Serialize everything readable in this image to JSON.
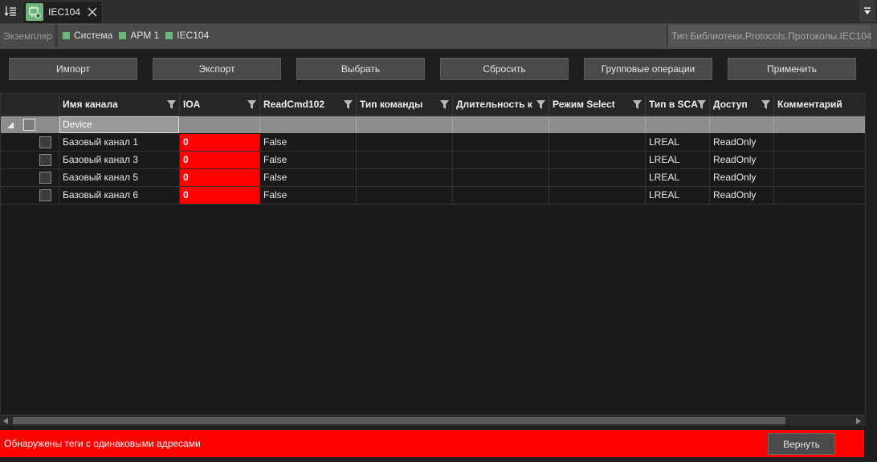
{
  "tab": {
    "title": "IEC104"
  },
  "breadcrumb": {
    "label": "Экземпляр",
    "items": [
      "Система",
      "АРМ 1",
      "IEC104"
    ],
    "library_path": "Тип Библиотеки.Protocols.Протоколы.IEC104"
  },
  "toolbar": {
    "import": "Импорт",
    "export": "Экспорт",
    "select": "Выбрать",
    "reset": "Сбросить",
    "group_ops": "Групповые операции",
    "apply": "Применить"
  },
  "table": {
    "columns": [
      "Имя канала",
      "IOA",
      "ReadCmd102",
      "Тип команды",
      "Длительность к",
      "Режим Select",
      "Тип в SCA",
      "Доступ",
      "Комментарий"
    ],
    "group": {
      "name": "Device"
    },
    "rows": [
      {
        "name": "Базовый канал 1",
        "ioa": "0",
        "readcmd": "False",
        "cmd_type": "",
        "duration": "",
        "select_mode": "",
        "sca_type": "LREAL",
        "access": "ReadOnly",
        "comment": ""
      },
      {
        "name": "Базовый канал 3",
        "ioa": "0",
        "readcmd": "False",
        "cmd_type": "",
        "duration": "",
        "select_mode": "",
        "sca_type": "LREAL",
        "access": "ReadOnly",
        "comment": ""
      },
      {
        "name": "Базовый канал 5",
        "ioa": "0",
        "readcmd": "False",
        "cmd_type": "",
        "duration": "",
        "select_mode": "",
        "sca_type": "LREAL",
        "access": "ReadOnly",
        "comment": ""
      },
      {
        "name": "Базовый канал 6",
        "ioa": "0",
        "readcmd": "False",
        "cmd_type": "",
        "duration": "",
        "select_mode": "",
        "sca_type": "LREAL",
        "access": "ReadOnly",
        "comment": ""
      }
    ]
  },
  "status": {
    "message": "Обнаружены теги с одинаковыми адресами",
    "revert": "Вернуть"
  },
  "colors": {
    "error": "#ff0000",
    "accent_green": "#6fb57a",
    "group_row": "#8d8d8d"
  },
  "icons": {
    "tab_menu": "list-down-icon",
    "tab": "network-module-icon",
    "close": "close-icon",
    "overflow": "dropdown-menu-icon",
    "filter": "filter-icon",
    "expand": "collapse-triangle-icon"
  }
}
